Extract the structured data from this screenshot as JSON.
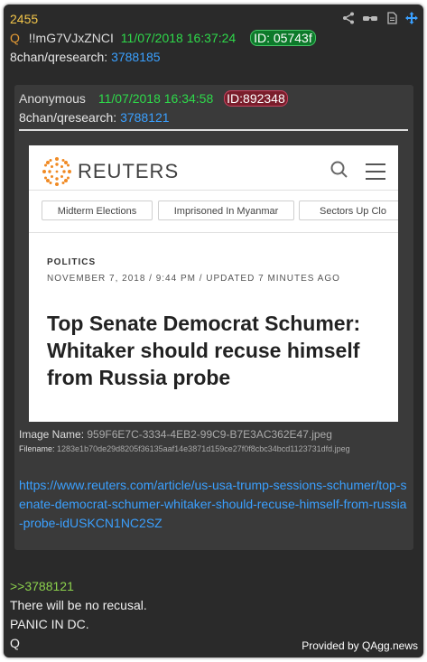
{
  "post": {
    "number": "2455",
    "q_mark": "Q",
    "tripcode": "!!mG7VJxZNCI",
    "datetime": "11/07/2018 16:37:24",
    "id": "ID: 05743f",
    "board": "8chan/qresearch:",
    "thread": "3788185"
  },
  "icons": [
    "share-icon",
    "glasses-icon",
    "document-icon",
    "move-icon"
  ],
  "quoted": {
    "name": "Anonymous",
    "datetime": "11/07/2018 16:34:58",
    "id": "ID:892348",
    "board": "8chan/qresearch:",
    "thread": "3788121",
    "image_name_label": "Image Name:",
    "image_name": "959F6E7C-3334-4EB2-99C9-B7E3AC362E47.jpeg",
    "filename_label": "Filename:",
    "filename": "1283e1b70de29d8205f36135aaf14e3871d159ce27f0f8cbc34bcd1123731dfd.jpeg",
    "url": "https://www.reuters.com/article/us-usa-trump-sessions-schumer/top-senate-democrat-schumer-whitaker-should-recuse-himself-from-russia-probe-idUSKCN1NC2SZ"
  },
  "screenshot": {
    "brand": "REUTERS",
    "chips": [
      "Midterm Elections",
      "Imprisoned In Myanmar",
      "Sectors Up Clo"
    ],
    "section": "POLITICS",
    "dateline": "NOVEMBER 7, 2018 / 9:44 PM / UPDATED 7 MINUTES AGO",
    "headline": "Top Senate Democrat Schumer: Whitaker should recuse himself from Russia probe"
  },
  "message": {
    "reply_ref": ">>3788121",
    "line1": "There will be no recusal.",
    "line2": "PANIC IN DC.",
    "line3": "Q"
  },
  "footer": {
    "provided": "Provided by QAgg.news"
  },
  "colors": {
    "background": "#2a2a2a",
    "post_number": "#f3c64a",
    "date": "#2ed94a",
    "link": "#3aa0ff",
    "greentext": "#8cd14d"
  }
}
